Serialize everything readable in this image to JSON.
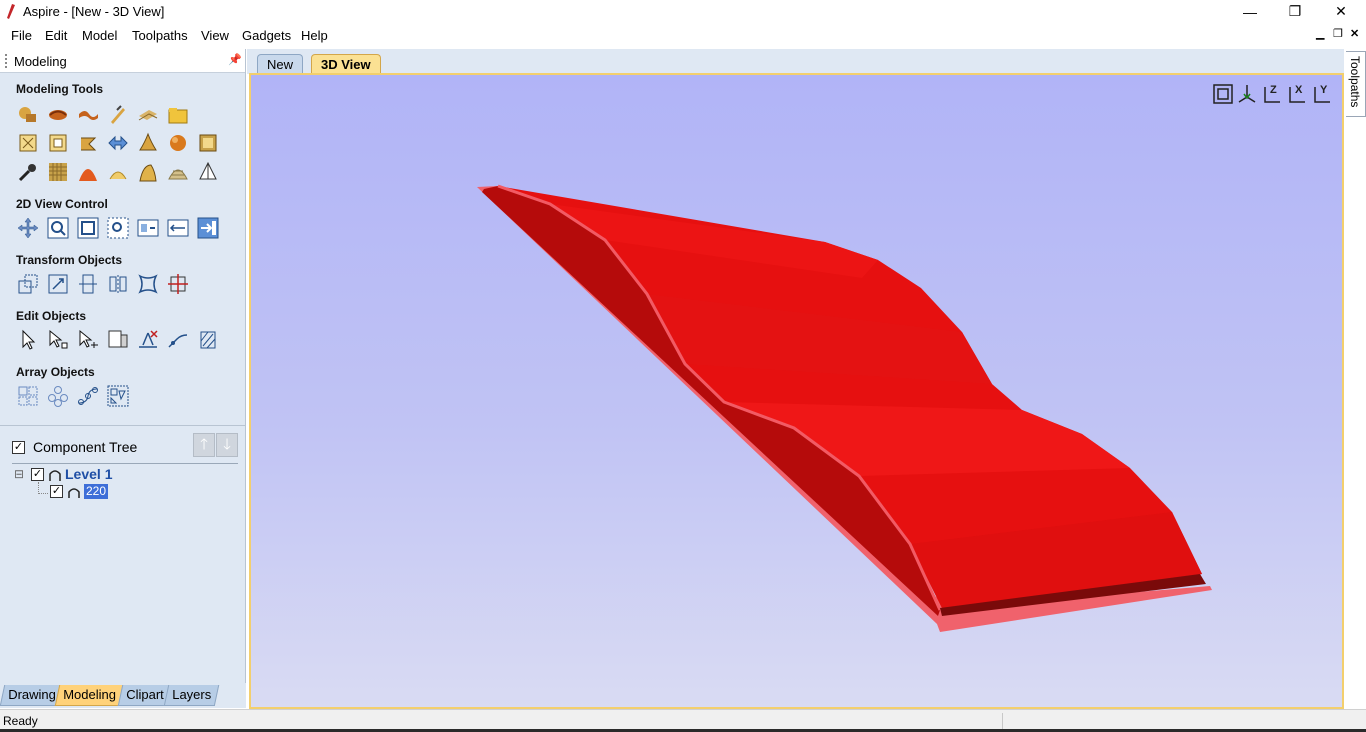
{
  "window": {
    "title": "Aspire - [New - 3D View]",
    "controls": {
      "minimize": "—",
      "restore": "❐",
      "close": "✕"
    }
  },
  "menu": {
    "items": [
      "File",
      "Edit",
      "Model",
      "Toolpaths",
      "View",
      "Gadgets",
      "Help"
    ],
    "mdi": {
      "minimize": "▁",
      "restore": "❐",
      "close": "✕"
    }
  },
  "left_panel": {
    "title": "Modeling",
    "pin": "📌",
    "sections": {
      "modeling_tools": "Modeling Tools",
      "view_control": "2D View Control",
      "transform": "Transform Objects",
      "edit": "Edit Objects",
      "array": "Array Objects"
    },
    "component_tree": {
      "title": "Component Tree",
      "up": "🡑",
      "down": "🡓",
      "level": "Level 1",
      "node": "220",
      "collapse": "⊟"
    },
    "tabs": [
      "Drawing",
      "Modeling",
      "Clipart",
      "Layers"
    ],
    "active_tab": "Modeling"
  },
  "document_tabs": [
    "New",
    "3D View"
  ],
  "active_document_tab": "3D View",
  "view_toolbar": {
    "icons": [
      "zoom-extents-icon",
      "iso-view-icon",
      "view-z-icon",
      "view-x-icon",
      "view-y-icon"
    ],
    "labels": [
      "",
      "",
      "Z",
      "X",
      "Y"
    ]
  },
  "model": {
    "color": "#e81010",
    "edge_color": "#f2606a",
    "shade_dark": "#b80a0a"
  },
  "right_strip": {
    "tab": "Toolpaths"
  },
  "status": {
    "text": "Ready"
  }
}
